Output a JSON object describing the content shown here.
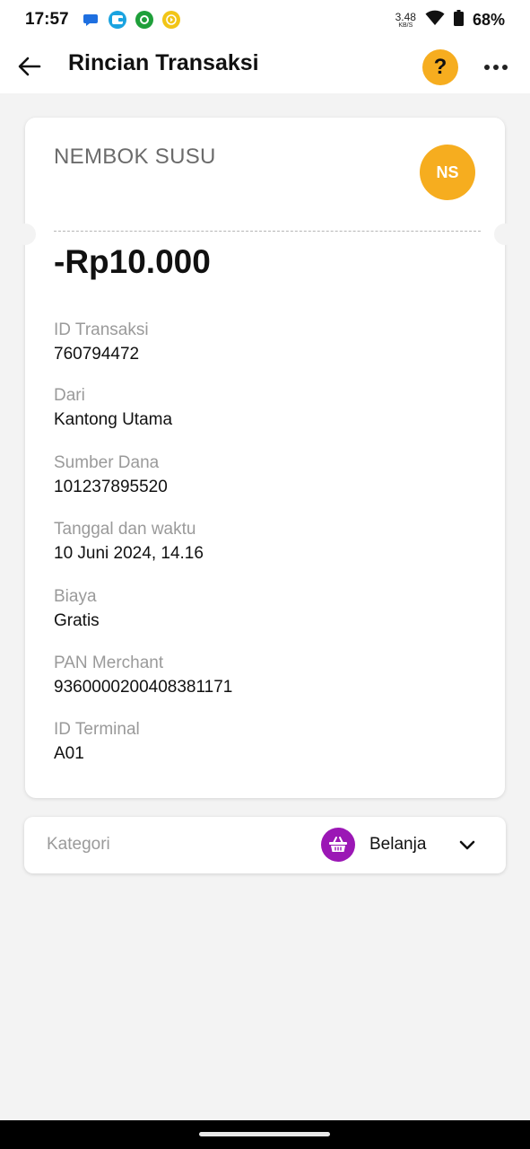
{
  "status_bar": {
    "time": "17:57",
    "net_speed_value": "3.48",
    "net_speed_unit": "KB/S",
    "battery": "68%",
    "notification_icons": [
      "chat-icon",
      "wallet-icon",
      "recycle-icon",
      "play-coin-icon"
    ]
  },
  "app_bar": {
    "title": "Rincian Transaksi",
    "help_label": "?"
  },
  "transaction": {
    "merchant_name": "NEMBOK SUSU",
    "merchant_initials": "NS",
    "amount": "-Rp10.000",
    "details": [
      {
        "label": "ID Transaksi",
        "value": "760794472"
      },
      {
        "label": "Dari",
        "value": "Kantong Utama"
      },
      {
        "label": "Sumber Dana",
        "value": "101237895520"
      },
      {
        "label": "Tanggal dan waktu",
        "value": "10 Juni 2024, 14.16"
      },
      {
        "label": "Biaya",
        "value": "Gratis"
      },
      {
        "label": "PAN Merchant",
        "value": "9360000200408381171"
      },
      {
        "label": "ID Terminal",
        "value": "A01"
      }
    ]
  },
  "category": {
    "label": "Kategori",
    "value": "Belanja",
    "icon": "shopping-basket-icon"
  },
  "colors": {
    "accent": "#f6ad1f",
    "category_icon_bg": "#9b17b5",
    "background": "#f3f3f3"
  }
}
